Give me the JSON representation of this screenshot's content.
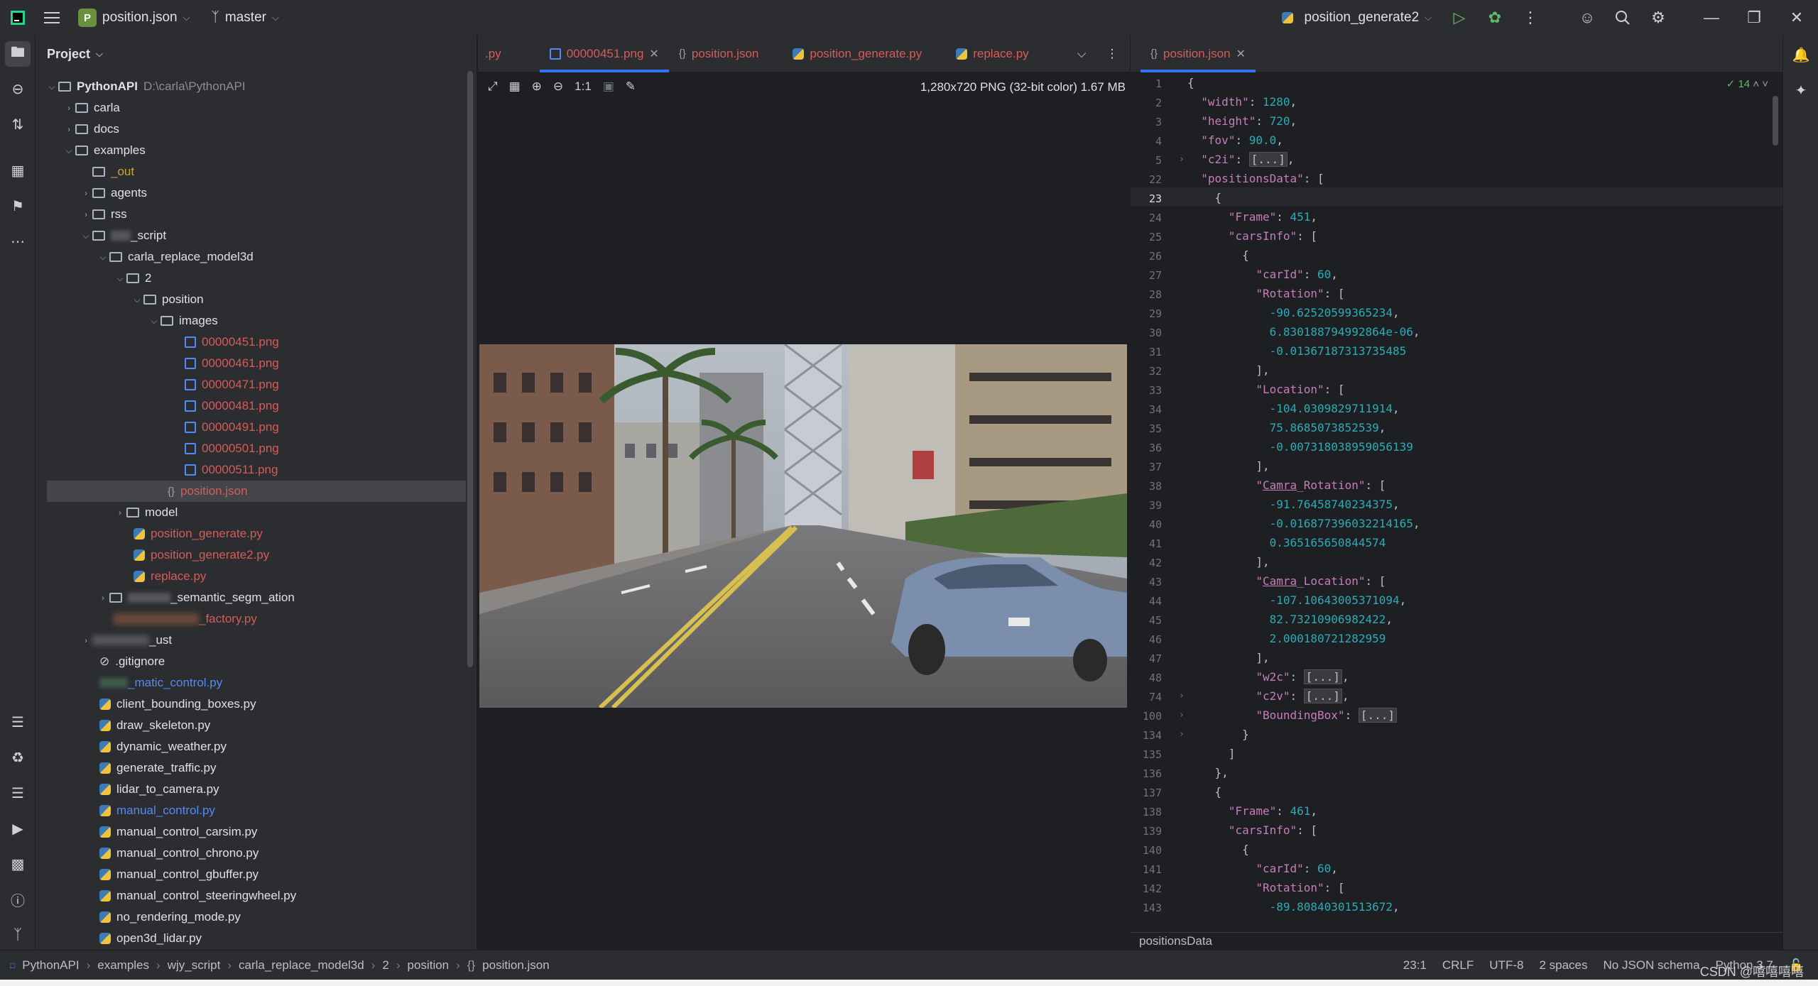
{
  "titlebar": {
    "project_badge": "P",
    "project_name": "position.json",
    "branch": "master",
    "run_config": "position_generate2"
  },
  "project_panel": {
    "title": "Project",
    "root_name": "PythonAPI",
    "root_path": "D:\\carla\\PythonAPI",
    "items": [
      {
        "label": "carla"
      },
      {
        "label": "docs"
      },
      {
        "label": "examples"
      },
      {
        "label": "_out"
      },
      {
        "label": "agents"
      },
      {
        "label": "rss"
      },
      {
        "label": "_script"
      },
      {
        "label": "carla_replace_model3d"
      },
      {
        "label": "2"
      },
      {
        "label": "position"
      },
      {
        "label": "images"
      },
      {
        "label": "00000451.png"
      },
      {
        "label": "00000461.png"
      },
      {
        "label": "00000471.png"
      },
      {
        "label": "00000481.png"
      },
      {
        "label": "00000491.png"
      },
      {
        "label": "00000501.png"
      },
      {
        "label": "00000511.png"
      },
      {
        "label": "position.json"
      },
      {
        "label": "model"
      },
      {
        "label": "position_generate.py"
      },
      {
        "label": "position_generate2.py"
      },
      {
        "label": "replace.py"
      },
      {
        "label": "_semantic_segm_ation"
      },
      {
        "label": "_factory.py"
      },
      {
        "label": "_ust"
      },
      {
        "label": ".gitignore"
      },
      {
        "label": "_matic_control.py"
      },
      {
        "label": "client_bounding_boxes.py"
      },
      {
        "label": "draw_skeleton.py"
      },
      {
        "label": "dynamic_weather.py"
      },
      {
        "label": "generate_traffic.py"
      },
      {
        "label": "lidar_to_camera.py"
      },
      {
        "label": "manual_control.py"
      },
      {
        "label": "manual_control_carsim.py"
      },
      {
        "label": "manual_control_chrono.py"
      },
      {
        "label": "manual_control_gbuffer.py"
      },
      {
        "label": "manual_control_steeringwheel.py"
      },
      {
        "label": "no_rendering_mode.py"
      },
      {
        "label": "open3d_lidar.py"
      }
    ]
  },
  "tabs_left": [
    {
      "label": ".py"
    },
    {
      "label": "00000451.png"
    },
    {
      "label": "position.json"
    },
    {
      "label": "position_generate.py"
    },
    {
      "label": "replace.py"
    }
  ],
  "tabs_right": [
    {
      "label": "position.json"
    }
  ],
  "viewer": {
    "zoom_label": "1:1",
    "image_info": "1,280x720 PNG (32-bit color) 1.67 MB"
  },
  "editor": {
    "inspections_count": "14",
    "line_numbers": [
      "1",
      "2",
      "3",
      "4",
      "5",
      "22",
      "23",
      "24",
      "25",
      "26",
      "27",
      "28",
      "29",
      "30",
      "31",
      "32",
      "33",
      "34",
      "35",
      "36",
      "37",
      "38",
      "39",
      "40",
      "41",
      "42",
      "43",
      "44",
      "45",
      "46",
      "47",
      "48",
      "74",
      "100",
      "134",
      "135",
      "136",
      "137",
      "138",
      "139",
      "140",
      "141",
      "142",
      "143"
    ],
    "current_line": "23",
    "breadcrumb": "positionsData"
  },
  "statusbar": {
    "crumbs": [
      "PythonAPI",
      "examples",
      "wjy_script",
      "carla_replace_model3d",
      "2",
      "position",
      "position.json"
    ],
    "position": "23:1",
    "line_ending": "CRLF",
    "encoding": "UTF-8",
    "indent": "2 spaces",
    "schema": "No JSON schema",
    "python": "Python 3.7",
    "watermark": "CSDN @嘻嘻嘻嘻"
  }
}
